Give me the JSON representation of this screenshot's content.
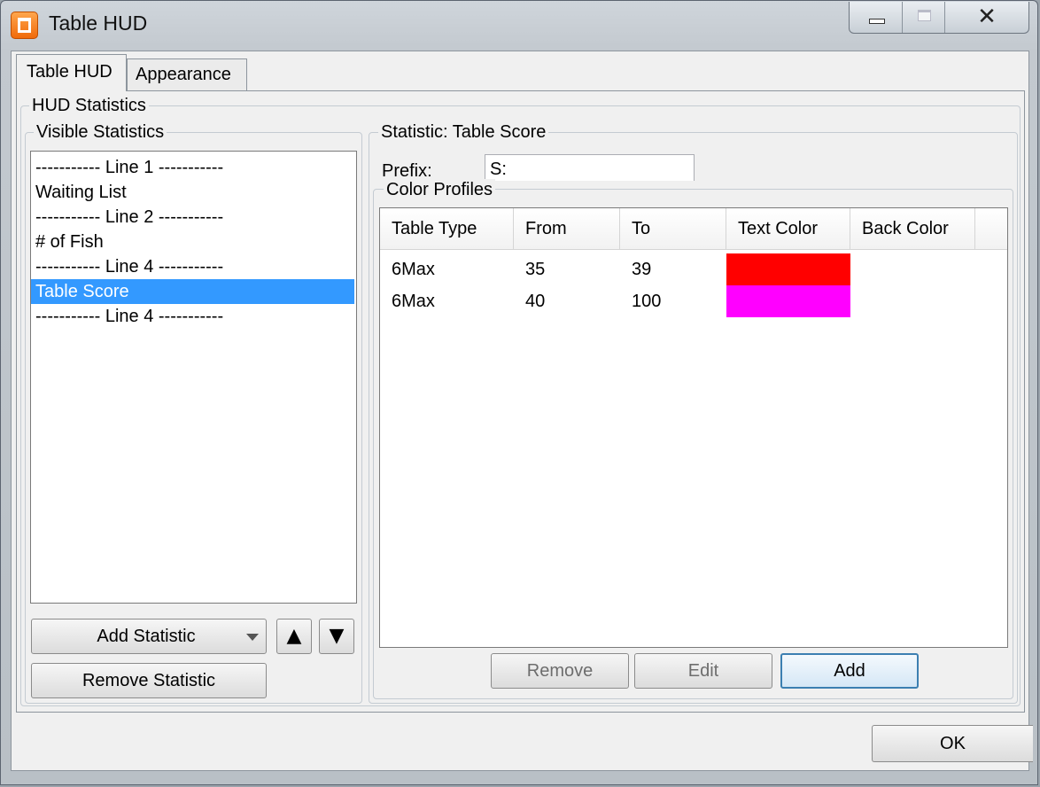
{
  "window": {
    "title": "Table HUD",
    "close_glyph": "✕",
    "icon": "app-logo-icon"
  },
  "tabs": [
    {
      "label": "Table HUD",
      "active": true
    },
    {
      "label": "Appearance",
      "active": false
    }
  ],
  "hud_statistics": {
    "title": "HUD Statistics",
    "visible_statistics": {
      "title": "Visible Statistics",
      "items": [
        {
          "label": "----------- Line 1 -----------",
          "selected": false
        },
        {
          "label": "Waiting List",
          "selected": false
        },
        {
          "label": "----------- Line 2 -----------",
          "selected": false
        },
        {
          "label": "# of Fish",
          "selected": false
        },
        {
          "label": "----------- Line 4 -----------",
          "selected": false
        },
        {
          "label": "Table Score",
          "selected": true
        },
        {
          "label": "----------- Line 4 -----------",
          "selected": false
        }
      ],
      "add_button": "Add Statistic",
      "up_glyph": "▲",
      "down_glyph": "▼",
      "remove_button": "Remove Statistic"
    },
    "statistic_detail": {
      "title": "Statistic: Table Score",
      "prefix_label": "Prefix:",
      "prefix_value": "S:",
      "color_profiles": {
        "title": "Color Profiles",
        "columns": [
          "Table Type",
          "From",
          "To",
          "Text Color",
          "Back Color"
        ],
        "rows": [
          {
            "table_type": "6Max",
            "from": "35",
            "to": "39",
            "text_color": "#ff0000",
            "back_color": ""
          },
          {
            "table_type": "6Max",
            "from": "40",
            "to": "100",
            "text_color": "#ff00ff",
            "back_color": ""
          }
        ],
        "buttons": {
          "remove": "Remove",
          "edit": "Edit",
          "add": "Add"
        }
      }
    }
  },
  "footer": {
    "ok_button": "OK"
  },
  "colors": {
    "selection": "#3399ff",
    "accent_border": "#3c7fb1"
  }
}
